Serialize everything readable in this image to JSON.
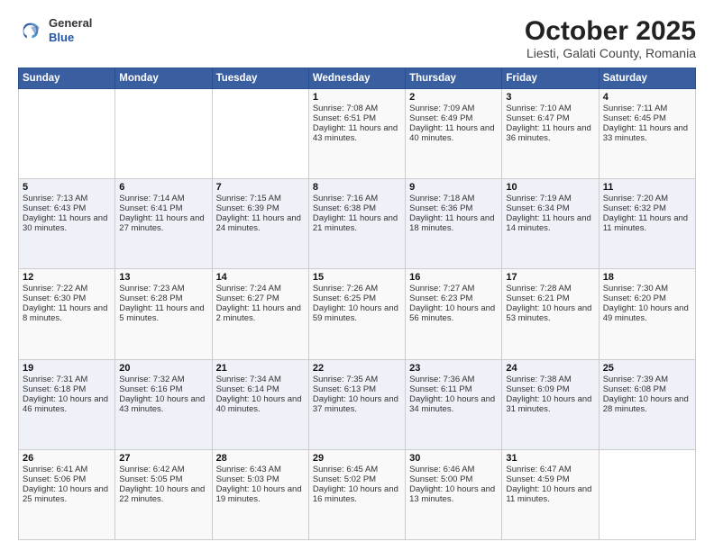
{
  "header": {
    "logo_general": "General",
    "logo_blue": "Blue",
    "month": "October 2025",
    "location": "Liesti, Galati County, Romania"
  },
  "weekdays": [
    "Sunday",
    "Monday",
    "Tuesday",
    "Wednesday",
    "Thursday",
    "Friday",
    "Saturday"
  ],
  "weeks": [
    [
      {
        "day": "",
        "info": ""
      },
      {
        "day": "",
        "info": ""
      },
      {
        "day": "",
        "info": ""
      },
      {
        "day": "1",
        "info": "Sunrise: 7:08 AM\nSunset: 6:51 PM\nDaylight: 11 hours and 43 minutes."
      },
      {
        "day": "2",
        "info": "Sunrise: 7:09 AM\nSunset: 6:49 PM\nDaylight: 11 hours and 40 minutes."
      },
      {
        "day": "3",
        "info": "Sunrise: 7:10 AM\nSunset: 6:47 PM\nDaylight: 11 hours and 36 minutes."
      },
      {
        "day": "4",
        "info": "Sunrise: 7:11 AM\nSunset: 6:45 PM\nDaylight: 11 hours and 33 minutes."
      }
    ],
    [
      {
        "day": "5",
        "info": "Sunrise: 7:13 AM\nSunset: 6:43 PM\nDaylight: 11 hours and 30 minutes."
      },
      {
        "day": "6",
        "info": "Sunrise: 7:14 AM\nSunset: 6:41 PM\nDaylight: 11 hours and 27 minutes."
      },
      {
        "day": "7",
        "info": "Sunrise: 7:15 AM\nSunset: 6:39 PM\nDaylight: 11 hours and 24 minutes."
      },
      {
        "day": "8",
        "info": "Sunrise: 7:16 AM\nSunset: 6:38 PM\nDaylight: 11 hours and 21 minutes."
      },
      {
        "day": "9",
        "info": "Sunrise: 7:18 AM\nSunset: 6:36 PM\nDaylight: 11 hours and 18 minutes."
      },
      {
        "day": "10",
        "info": "Sunrise: 7:19 AM\nSunset: 6:34 PM\nDaylight: 11 hours and 14 minutes."
      },
      {
        "day": "11",
        "info": "Sunrise: 7:20 AM\nSunset: 6:32 PM\nDaylight: 11 hours and 11 minutes."
      }
    ],
    [
      {
        "day": "12",
        "info": "Sunrise: 7:22 AM\nSunset: 6:30 PM\nDaylight: 11 hours and 8 minutes."
      },
      {
        "day": "13",
        "info": "Sunrise: 7:23 AM\nSunset: 6:28 PM\nDaylight: 11 hours and 5 minutes."
      },
      {
        "day": "14",
        "info": "Sunrise: 7:24 AM\nSunset: 6:27 PM\nDaylight: 11 hours and 2 minutes."
      },
      {
        "day": "15",
        "info": "Sunrise: 7:26 AM\nSunset: 6:25 PM\nDaylight: 10 hours and 59 minutes."
      },
      {
        "day": "16",
        "info": "Sunrise: 7:27 AM\nSunset: 6:23 PM\nDaylight: 10 hours and 56 minutes."
      },
      {
        "day": "17",
        "info": "Sunrise: 7:28 AM\nSunset: 6:21 PM\nDaylight: 10 hours and 53 minutes."
      },
      {
        "day": "18",
        "info": "Sunrise: 7:30 AM\nSunset: 6:20 PM\nDaylight: 10 hours and 49 minutes."
      }
    ],
    [
      {
        "day": "19",
        "info": "Sunrise: 7:31 AM\nSunset: 6:18 PM\nDaylight: 10 hours and 46 minutes."
      },
      {
        "day": "20",
        "info": "Sunrise: 7:32 AM\nSunset: 6:16 PM\nDaylight: 10 hours and 43 minutes."
      },
      {
        "day": "21",
        "info": "Sunrise: 7:34 AM\nSunset: 6:14 PM\nDaylight: 10 hours and 40 minutes."
      },
      {
        "day": "22",
        "info": "Sunrise: 7:35 AM\nSunset: 6:13 PM\nDaylight: 10 hours and 37 minutes."
      },
      {
        "day": "23",
        "info": "Sunrise: 7:36 AM\nSunset: 6:11 PM\nDaylight: 10 hours and 34 minutes."
      },
      {
        "day": "24",
        "info": "Sunrise: 7:38 AM\nSunset: 6:09 PM\nDaylight: 10 hours and 31 minutes."
      },
      {
        "day": "25",
        "info": "Sunrise: 7:39 AM\nSunset: 6:08 PM\nDaylight: 10 hours and 28 minutes."
      }
    ],
    [
      {
        "day": "26",
        "info": "Sunrise: 6:41 AM\nSunset: 5:06 PM\nDaylight: 10 hours and 25 minutes."
      },
      {
        "day": "27",
        "info": "Sunrise: 6:42 AM\nSunset: 5:05 PM\nDaylight: 10 hours and 22 minutes."
      },
      {
        "day": "28",
        "info": "Sunrise: 6:43 AM\nSunset: 5:03 PM\nDaylight: 10 hours and 19 minutes."
      },
      {
        "day": "29",
        "info": "Sunrise: 6:45 AM\nSunset: 5:02 PM\nDaylight: 10 hours and 16 minutes."
      },
      {
        "day": "30",
        "info": "Sunrise: 6:46 AM\nSunset: 5:00 PM\nDaylight: 10 hours and 13 minutes."
      },
      {
        "day": "31",
        "info": "Sunrise: 6:47 AM\nSunset: 4:59 PM\nDaylight: 10 hours and 11 minutes."
      },
      {
        "day": "",
        "info": ""
      }
    ]
  ]
}
